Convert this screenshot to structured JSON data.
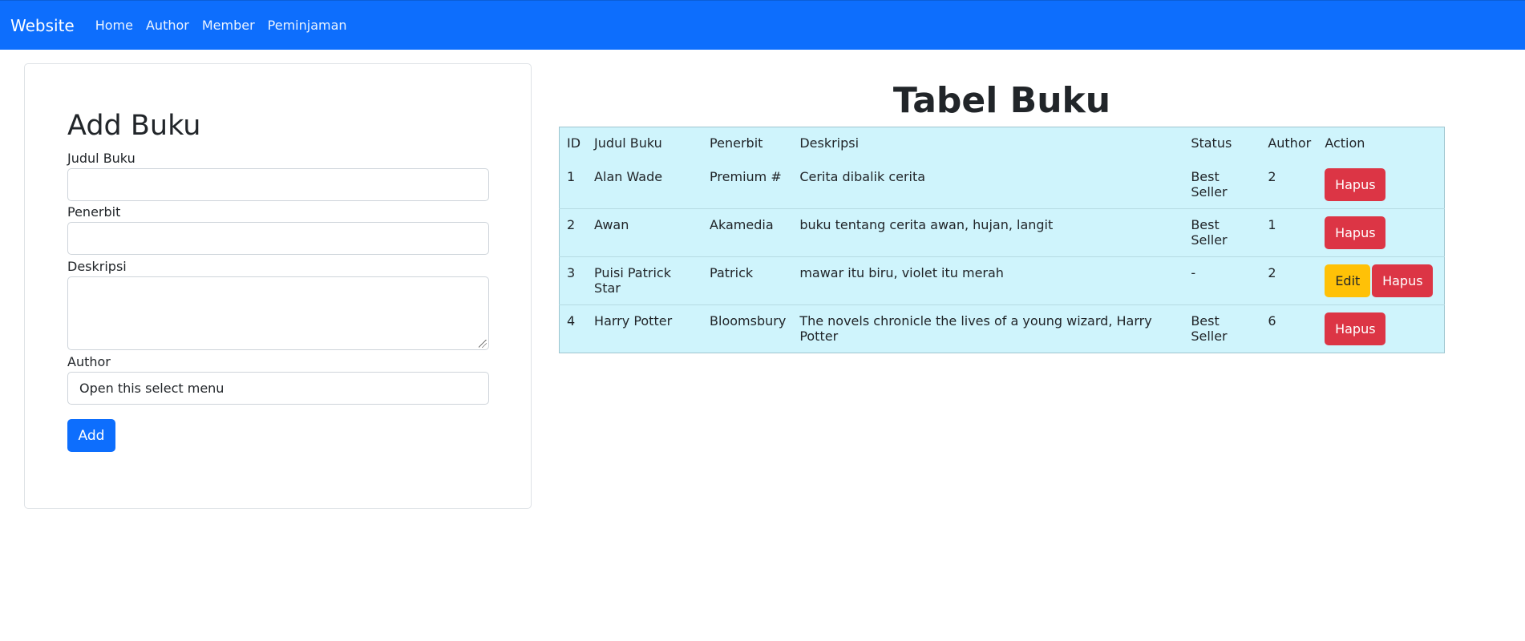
{
  "navbar": {
    "brand": "Website",
    "links": [
      "Home",
      "Author",
      "Member",
      "Peminjaman"
    ]
  },
  "form": {
    "title": "Add Buku",
    "judul_label": "Judul Buku",
    "judul_value": "",
    "penerbit_label": "Penerbit",
    "penerbit_value": "",
    "deskripsi_label": "Deskripsi",
    "deskripsi_value": "",
    "author_label": "Author",
    "author_select": "Open this select menu",
    "add_label": "Add"
  },
  "table": {
    "title": "Tabel Buku",
    "headers": [
      "ID",
      "Judul Buku",
      "Penerbit",
      "Deskripsi",
      "Status",
      "Author",
      "Action"
    ],
    "rows": [
      {
        "id": "1",
        "judul": "Alan Wade",
        "penerbit": "Premium #",
        "deskripsi": "Cerita dibalik cerita",
        "status": "Best Seller",
        "author": "2",
        "edit": "",
        "hapus": "Hapus"
      },
      {
        "id": "2",
        "judul": "Awan",
        "penerbit": "Akamedia",
        "deskripsi": "buku tentang cerita awan, hujan, langit",
        "status": "Best Seller",
        "author": "1",
        "edit": "",
        "hapus": "Hapus"
      },
      {
        "id": "3",
        "judul": "Puisi Patrick Star",
        "penerbit": "Patrick",
        "deskripsi": "mawar itu biru, violet itu merah",
        "status": "-",
        "author": "2",
        "edit": "Edit",
        "hapus": "Hapus"
      },
      {
        "id": "4",
        "judul": "Harry Potter",
        "penerbit": "Bloomsbury",
        "deskripsi": "The novels chronicle the lives of a young wizard, Harry Potter",
        "status": "Best Seller",
        "author": "6",
        "edit": "",
        "hapus": "Hapus"
      }
    ]
  },
  "colors": {
    "primary": "#0d6efd",
    "danger": "#dc3545",
    "warning": "#ffc107",
    "table_bg": "#cff4fc"
  }
}
